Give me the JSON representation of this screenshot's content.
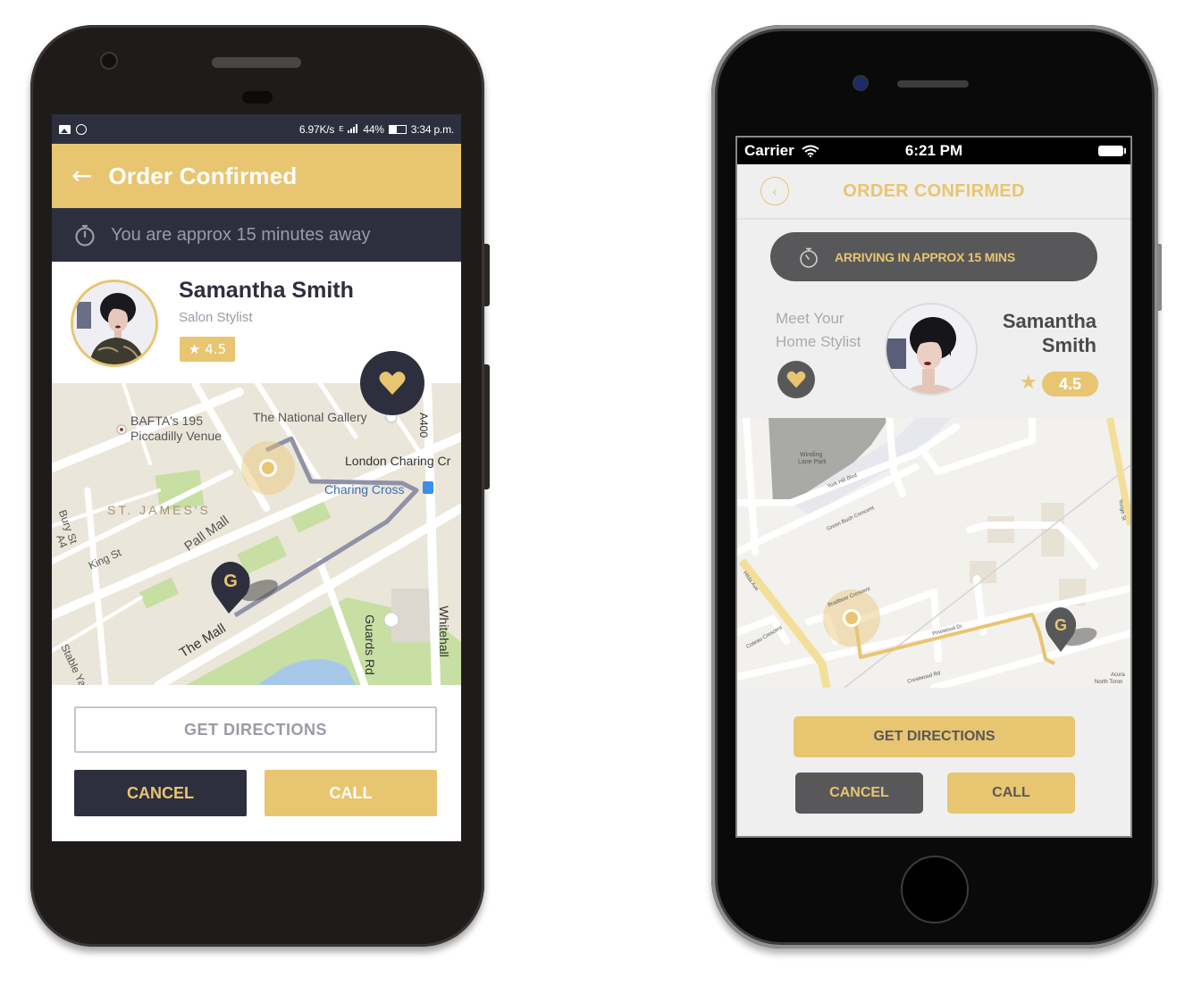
{
  "android_phone": {
    "status_bar": {
      "speed": "6.97K/s",
      "signal": "E",
      "battery": "44%",
      "time": "3:34 p.m."
    },
    "header": {
      "back_icon": "arrow-left-icon",
      "title": "Order Confirmed"
    },
    "eta_banner": {
      "icon": "stopwatch-icon",
      "text": "You are approx 15 minutes away"
    },
    "stylist": {
      "name": "Samantha Smith",
      "role": "Salon Stylist",
      "rating": "4.5",
      "favorite_icon": "heart-icon"
    },
    "map": {
      "labels": [
        "BAFTA's 195",
        "Piccadilly Venue",
        "The National Gallery",
        "London Charing Cr",
        "Charing Cross",
        "ST. JAMES'S",
        "Bury St",
        "King St",
        "A4",
        "Pall Mall",
        "The Mall",
        "Stable Yard",
        "Guards Rd",
        "Whitehall",
        "A400"
      ],
      "marker_letter": "G"
    },
    "buttons": {
      "get_directions": "GET DIRECTIONS",
      "cancel": "CANCEL",
      "call": "CALL"
    }
  },
  "iphone": {
    "status_bar": {
      "carrier": "Carrier",
      "time": "6:21 PM"
    },
    "header": {
      "back_icon": "chevron-left-icon",
      "title": "ORDER CONFIRMED"
    },
    "eta_banner": {
      "icon": "stopwatch-icon",
      "text": "ARRIVING IN APPROX 15 MINS"
    },
    "stylist": {
      "intro_line1": "Meet Your",
      "intro_line2": "Home Stylist",
      "first_name": "Samantha",
      "last_name": "Smith",
      "rating": "4.5",
      "favorite_icon": "heart-icon"
    },
    "map": {
      "labels": [
        "Winding",
        "Lane Park",
        "York Hill Blvd",
        "Green Bush Crescent",
        "Hilda Ave",
        "Bradbeer Crescent",
        "Pinewood Dr",
        "Crestwood Rd",
        "Coteau Crescent",
        "Yonge St",
        "Acura",
        "North Toron"
      ],
      "marker_letter": "G"
    },
    "buttons": {
      "get_directions": "GET DIRECTIONS",
      "cancel": "CANCEL",
      "call": "CALL"
    }
  },
  "colors": {
    "gold": "#e8c570",
    "navy": "#2e2f3e",
    "charcoal": "#58585a"
  }
}
